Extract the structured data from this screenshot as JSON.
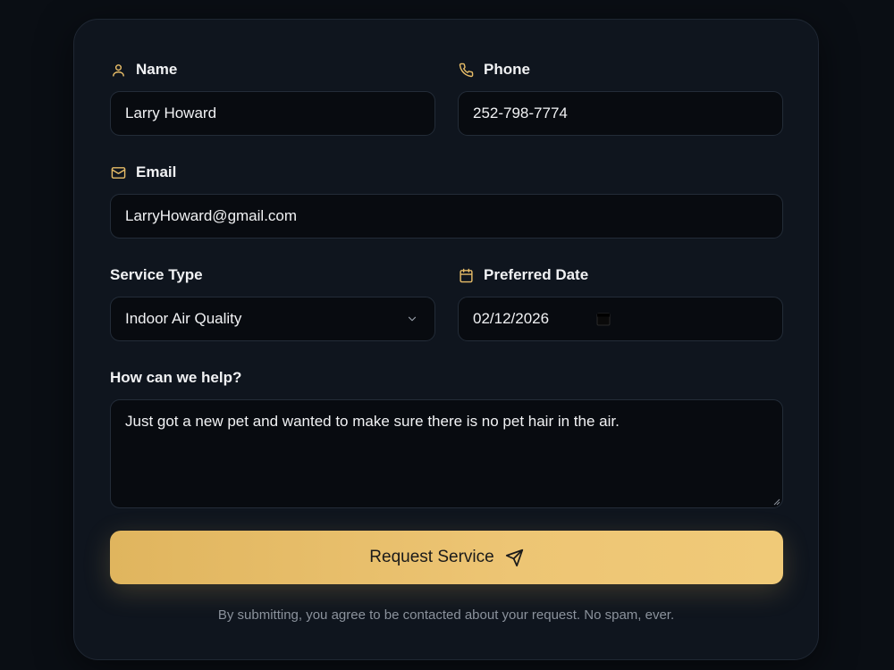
{
  "form": {
    "name": {
      "label": "Name",
      "value": "Larry Howard",
      "icon": "user-icon"
    },
    "phone": {
      "label": "Phone",
      "value": "252-798-7774",
      "icon": "phone-icon"
    },
    "email": {
      "label": "Email",
      "value": "LarryHoward@gmail.com",
      "icon": "mail-icon"
    },
    "service_type": {
      "label": "Service Type",
      "selected": "Indoor Air Quality"
    },
    "preferred_date": {
      "label": "Preferred Date",
      "value": "02/12/2026",
      "icon": "calendar-icon"
    },
    "message": {
      "label": "How can we help?",
      "value": "Just got a new pet and wanted to make sure there is no pet hair in the air."
    },
    "submit_label": "Request Service",
    "disclaimer": "By submitting, you agree to be contacted about your request. No spam, ever."
  },
  "colors": {
    "accent": "#e8bd68",
    "background": "#0a0e14",
    "card": "#0f151e",
    "input": "#080b10"
  }
}
